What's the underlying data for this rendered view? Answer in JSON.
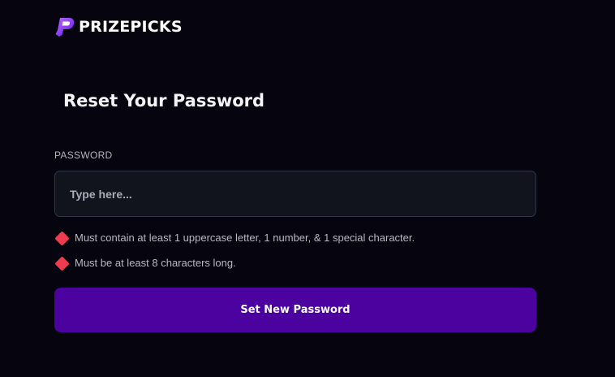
{
  "brand": {
    "name": "PRIZEPICKS",
    "logo_icon": "prizepicks-p-icon",
    "accent_color": "#8b3dff"
  },
  "form": {
    "title": "Reset Your Password",
    "password_label": "PASSWORD",
    "password_placeholder": "Type here...",
    "password_value": "",
    "requirements": [
      {
        "icon": "error-diamond-icon",
        "text": "Must contain at least 1 uppercase letter, 1 number, & 1 special character."
      },
      {
        "icon": "error-diamond-icon",
        "text": "Must be at least 8 characters long."
      }
    ],
    "submit_label": "Set New Password"
  },
  "colors": {
    "background": "#05040f",
    "input_background": "#11131d",
    "input_border": "#33354a",
    "error": "#ef3b4f",
    "button": "#4b029f"
  }
}
